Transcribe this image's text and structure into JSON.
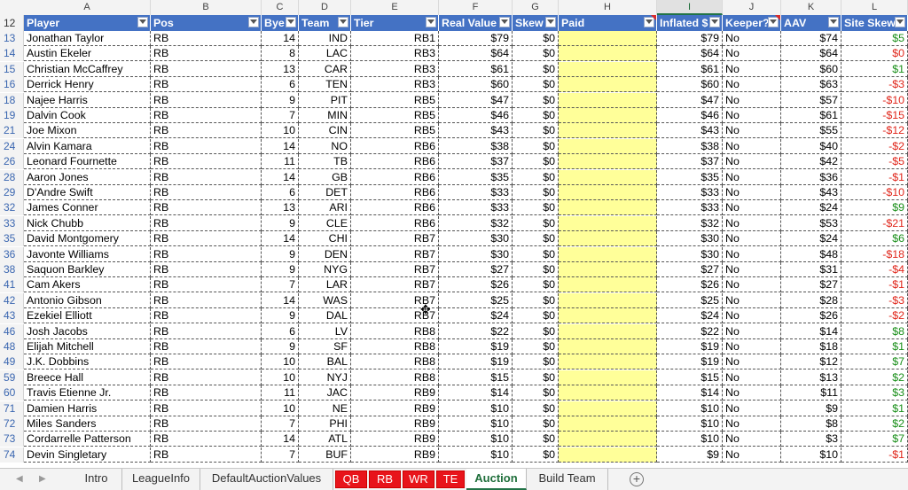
{
  "columns": [
    "A",
    "B",
    "C",
    "D",
    "E",
    "F",
    "G",
    "H",
    "I",
    "J",
    "K",
    "L"
  ],
  "selected_column": "I",
  "header_row_number": "12",
  "headers": [
    "Player",
    "Pos",
    "Bye",
    "Team",
    "Tier",
    "Real Value",
    "Skew",
    "Paid",
    "Inflated $",
    "Keeper?",
    "AAV",
    "Site Skew"
  ],
  "rows": [
    {
      "n": "13",
      "player": "Jonathan Taylor",
      "pos": "RB",
      "bye": "14",
      "team": "IND",
      "tier": "RB1",
      "real": "$79",
      "skew": "$0",
      "inflated": "$79",
      "keeper": "No",
      "aav": "$74",
      "site": "$5",
      "site_sign": "pos"
    },
    {
      "n": "14",
      "player": "Austin Ekeler",
      "pos": "RB",
      "bye": "8",
      "team": "LAC",
      "tier": "RB3",
      "real": "$64",
      "skew": "$0",
      "inflated": "$64",
      "keeper": "No",
      "aav": "$64",
      "site": "$0",
      "site_sign": "neg"
    },
    {
      "n": "15",
      "player": "Christian McCaffrey",
      "pos": "RB",
      "bye": "13",
      "team": "CAR",
      "tier": "RB3",
      "real": "$61",
      "skew": "$0",
      "inflated": "$61",
      "keeper": "No",
      "aav": "$60",
      "site": "$1",
      "site_sign": "pos"
    },
    {
      "n": "16",
      "player": "Derrick Henry",
      "pos": "RB",
      "bye": "6",
      "team": "TEN",
      "tier": "RB3",
      "real": "$60",
      "skew": "$0",
      "inflated": "$60",
      "keeper": "No",
      "aav": "$63",
      "site": "-$3",
      "site_sign": "neg"
    },
    {
      "n": "18",
      "player": "Najee Harris",
      "pos": "RB",
      "bye": "9",
      "team": "PIT",
      "tier": "RB5",
      "real": "$47",
      "skew": "$0",
      "inflated": "$47",
      "keeper": "No",
      "aav": "$57",
      "site": "-$10",
      "site_sign": "neg"
    },
    {
      "n": "19",
      "player": "Dalvin Cook",
      "pos": "RB",
      "bye": "7",
      "team": "MIN",
      "tier": "RB5",
      "real": "$46",
      "skew": "$0",
      "inflated": "$46",
      "keeper": "No",
      "aav": "$61",
      "site": "-$15",
      "site_sign": "neg"
    },
    {
      "n": "21",
      "player": "Joe Mixon",
      "pos": "RB",
      "bye": "10",
      "team": "CIN",
      "tier": "RB5",
      "real": "$43",
      "skew": "$0",
      "inflated": "$43",
      "keeper": "No",
      "aav": "$55",
      "site": "-$12",
      "site_sign": "neg"
    },
    {
      "n": "24",
      "player": "Alvin Kamara",
      "pos": "RB",
      "bye": "14",
      "team": "NO",
      "tier": "RB6",
      "real": "$38",
      "skew": "$0",
      "inflated": "$38",
      "keeper": "No",
      "aav": "$40",
      "site": "-$2",
      "site_sign": "neg"
    },
    {
      "n": "26",
      "player": "Leonard Fournette",
      "pos": "RB",
      "bye": "11",
      "team": "TB",
      "tier": "RB6",
      "real": "$37",
      "skew": "$0",
      "inflated": "$37",
      "keeper": "No",
      "aav": "$42",
      "site": "-$5",
      "site_sign": "neg"
    },
    {
      "n": "28",
      "player": "Aaron Jones",
      "pos": "RB",
      "bye": "14",
      "team": "GB",
      "tier": "RB6",
      "real": "$35",
      "skew": "$0",
      "inflated": "$35",
      "keeper": "No",
      "aav": "$36",
      "site": "-$1",
      "site_sign": "neg"
    },
    {
      "n": "29",
      "player": "D'Andre Swift",
      "pos": "RB",
      "bye": "6",
      "team": "DET",
      "tier": "RB6",
      "real": "$33",
      "skew": "$0",
      "inflated": "$33",
      "keeper": "No",
      "aav": "$43",
      "site": "-$10",
      "site_sign": "neg"
    },
    {
      "n": "32",
      "player": "James Conner",
      "pos": "RB",
      "bye": "13",
      "team": "ARI",
      "tier": "RB6",
      "real": "$33",
      "skew": "$0",
      "inflated": "$33",
      "keeper": "No",
      "aav": "$24",
      "site": "$9",
      "site_sign": "pos"
    },
    {
      "n": "33",
      "player": "Nick Chubb",
      "pos": "RB",
      "bye": "9",
      "team": "CLE",
      "tier": "RB6",
      "real": "$32",
      "skew": "$0",
      "inflated": "$32",
      "keeper": "No",
      "aav": "$53",
      "site": "-$21",
      "site_sign": "neg"
    },
    {
      "n": "35",
      "player": "David Montgomery",
      "pos": "RB",
      "bye": "14",
      "team": "CHI",
      "tier": "RB7",
      "real": "$30",
      "skew": "$0",
      "inflated": "$30",
      "keeper": "No",
      "aav": "$24",
      "site": "$6",
      "site_sign": "pos"
    },
    {
      "n": "36",
      "player": "Javonte Williams",
      "pos": "RB",
      "bye": "9",
      "team": "DEN",
      "tier": "RB7",
      "real": "$30",
      "skew": "$0",
      "inflated": "$30",
      "keeper": "No",
      "aav": "$48",
      "site": "-$18",
      "site_sign": "neg"
    },
    {
      "n": "38",
      "player": "Saquon Barkley",
      "pos": "RB",
      "bye": "9",
      "team": "NYG",
      "tier": "RB7",
      "real": "$27",
      "skew": "$0",
      "inflated": "$27",
      "keeper": "No",
      "aav": "$31",
      "site": "-$4",
      "site_sign": "neg"
    },
    {
      "n": "41",
      "player": "Cam Akers",
      "pos": "RB",
      "bye": "7",
      "team": "LAR",
      "tier": "RB7",
      "real": "$26",
      "skew": "$0",
      "inflated": "$26",
      "keeper": "No",
      "aav": "$27",
      "site": "-$1",
      "site_sign": "neg"
    },
    {
      "n": "42",
      "player": "Antonio Gibson",
      "pos": "RB",
      "bye": "14",
      "team": "WAS",
      "tier": "RB7",
      "real": "$25",
      "skew": "$0",
      "inflated": "$25",
      "keeper": "No",
      "aav": "$28",
      "site": "-$3",
      "site_sign": "neg"
    },
    {
      "n": "43",
      "player": "Ezekiel Elliott",
      "pos": "RB",
      "bye": "9",
      "team": "DAL",
      "tier": "RB7",
      "real": "$24",
      "skew": "$0",
      "inflated": "$24",
      "keeper": "No",
      "aav": "$26",
      "site": "-$2",
      "site_sign": "neg"
    },
    {
      "n": "46",
      "player": "Josh Jacobs",
      "pos": "RB",
      "bye": "6",
      "team": "LV",
      "tier": "RB8",
      "real": "$22",
      "skew": "$0",
      "inflated": "$22",
      "keeper": "No",
      "aav": "$14",
      "site": "$8",
      "site_sign": "pos"
    },
    {
      "n": "48",
      "player": "Elijah Mitchell",
      "pos": "RB",
      "bye": "9",
      "team": "SF",
      "tier": "RB8",
      "real": "$19",
      "skew": "$0",
      "inflated": "$19",
      "keeper": "No",
      "aav": "$18",
      "site": "$1",
      "site_sign": "pos"
    },
    {
      "n": "49",
      "player": "J.K. Dobbins",
      "pos": "RB",
      "bye": "10",
      "team": "BAL",
      "tier": "RB8",
      "real": "$19",
      "skew": "$0",
      "inflated": "$19",
      "keeper": "No",
      "aav": "$12",
      "site": "$7",
      "site_sign": "pos"
    },
    {
      "n": "59",
      "player": "Breece Hall",
      "pos": "RB",
      "bye": "10",
      "team": "NYJ",
      "tier": "RB8",
      "real": "$15",
      "skew": "$0",
      "inflated": "$15",
      "keeper": "No",
      "aav": "$13",
      "site": "$2",
      "site_sign": "pos"
    },
    {
      "n": "60",
      "player": "Travis Etienne Jr.",
      "pos": "RB",
      "bye": "11",
      "team": "JAC",
      "tier": "RB9",
      "real": "$14",
      "skew": "$0",
      "inflated": "$14",
      "keeper": "No",
      "aav": "$11",
      "site": "$3",
      "site_sign": "pos"
    },
    {
      "n": "71",
      "player": "Damien Harris",
      "pos": "RB",
      "bye": "10",
      "team": "NE",
      "tier": "RB9",
      "real": "$10",
      "skew": "$0",
      "inflated": "$10",
      "keeper": "No",
      "aav": "$9",
      "site": "$1",
      "site_sign": "pos"
    },
    {
      "n": "72",
      "player": "Miles Sanders",
      "pos": "RB",
      "bye": "7",
      "team": "PHI",
      "tier": "RB9",
      "real": "$10",
      "skew": "$0",
      "inflated": "$10",
      "keeper": "No",
      "aav": "$8",
      "site": "$2",
      "site_sign": "pos"
    },
    {
      "n": "73",
      "player": "Cordarrelle Patterson",
      "pos": "RB",
      "bye": "14",
      "team": "ATL",
      "tier": "RB9",
      "real": "$10",
      "skew": "$0",
      "inflated": "$10",
      "keeper": "No",
      "aav": "$3",
      "site": "$7",
      "site_sign": "pos"
    },
    {
      "n": "74",
      "player": "Devin Singletary",
      "pos": "RB",
      "bye": "7",
      "team": "BUF",
      "tier": "RB9",
      "real": "$10",
      "skew": "$0",
      "inflated": "$9",
      "keeper": "No",
      "aav": "$10",
      "site": "-$1",
      "site_sign": "neg"
    }
  ],
  "sheet_tabs": [
    {
      "label": "Intro",
      "style": "plain"
    },
    {
      "label": "LeagueInfo",
      "style": "plain"
    },
    {
      "label": "DefaultAuctionValues",
      "style": "plain"
    },
    {
      "label": "QB",
      "style": "red"
    },
    {
      "label": "RB",
      "style": "red"
    },
    {
      "label": "WR",
      "style": "red"
    },
    {
      "label": "TE",
      "style": "red"
    },
    {
      "label": "Auction",
      "style": "active"
    },
    {
      "label": "Build Team",
      "style": "plain"
    }
  ],
  "icons": {
    "filter": "filter-dropdown-icon",
    "filter_active": "filter-applied-icon",
    "sort": "sort-descending-icon",
    "add_sheet": "add-sheet-icon",
    "scroll_left": "scroll-left-icon",
    "scroll_right": "scroll-right-icon"
  },
  "colors": {
    "header_fill": "#4472c4",
    "paid_fill": "#ffff99",
    "positive": "#1a8f1a",
    "negative": "#e0261b",
    "red_tab": "#e8141b",
    "active_tab_text": "#1e6e3a"
  }
}
